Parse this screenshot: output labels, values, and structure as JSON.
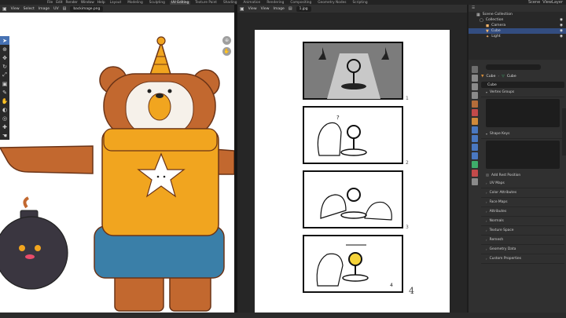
{
  "topbar": {
    "menus": [
      "File",
      "Edit",
      "Render",
      "Window",
      "Help"
    ],
    "workspaces": [
      "Layout",
      "Modeling",
      "Sculpting",
      "UV Editing",
      "Texture Paint",
      "Shading",
      "Animation",
      "Rendering",
      "Compositing",
      "Geometry Nodes",
      "Scripting"
    ],
    "active_workspace": "UV Editing",
    "scene": "Scene",
    "view_layer": "ViewLayer"
  },
  "left_editor": {
    "menus": [
      "View",
      "Select",
      "Image",
      "UV"
    ],
    "image_name": "backimage.png"
  },
  "mid_editor": {
    "menus": [
      "View",
      "View",
      "Image"
    ],
    "image_name": "1.jpg"
  },
  "storyboard": {
    "frame_numbers": [
      "1",
      "2",
      "3",
      "4"
    ],
    "page_number": "4"
  },
  "outliner": {
    "title": "Scene Collection",
    "items": [
      {
        "label": "Collection",
        "level": 0
      },
      {
        "label": "Camera",
        "level": 1
      },
      {
        "label": "Cube",
        "level": 1
      },
      {
        "label": "Light",
        "level": 1
      }
    ]
  },
  "properties": {
    "breadcrumb_object": "Cube",
    "breadcrumb_data": "Cube",
    "mesh_name": "Cube",
    "sections": [
      "Vertex Groups",
      "Shape Keys"
    ],
    "rest_position_label": "Add Rest Position",
    "sections2": [
      "UV Maps",
      "Color Attributes",
      "Face Maps",
      "Attributes",
      "Normals",
      "Texture Space",
      "Remesh",
      "Geometry Data",
      "Custom Properties"
    ]
  },
  "colors": {
    "bear_brown": "#c2682f",
    "shirt_yellow": "#f1a51f",
    "pants_blue": "#3a7fa8",
    "bomb": "#3a3640",
    "accent": "#4772b3"
  }
}
